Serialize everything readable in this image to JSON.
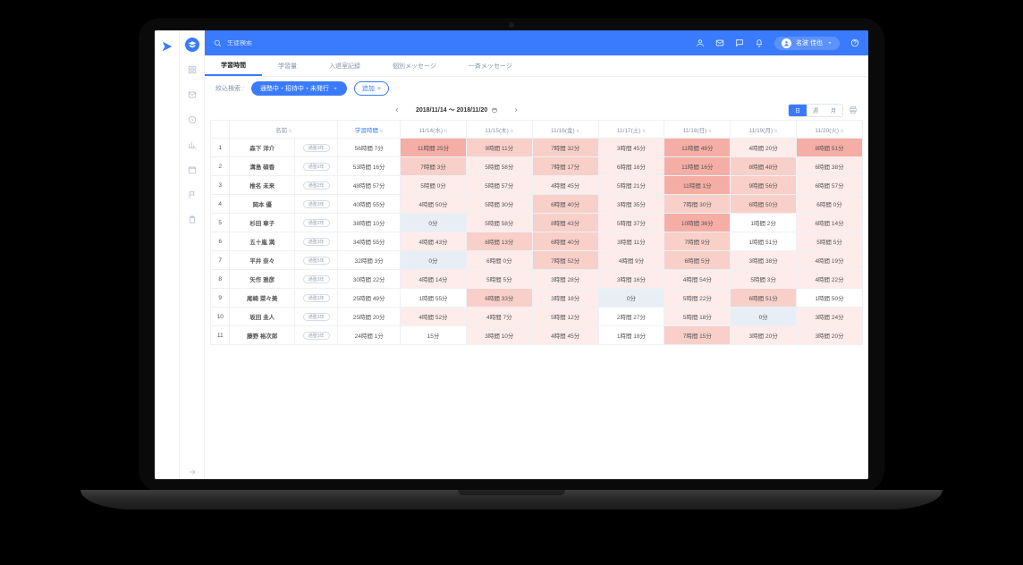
{
  "search": {
    "placeholder": "生徒検索"
  },
  "user": {
    "name": "名波 佳也"
  },
  "tabs": [
    "学習時間",
    "学習量",
    "入退室記録",
    "個別メッセージ",
    "一斉メッセージ"
  ],
  "filter": {
    "label": "絞込検索 :",
    "pill": "通塾中・招待中・未発行",
    "add": "追加"
  },
  "dateRange": "2018/11/14 〜 2018/11/20",
  "segments": [
    "日",
    "週",
    "月"
  ],
  "columns": {
    "name": "名前",
    "study": "学習時間",
    "days": [
      "11/14(水)",
      "11/15(木)",
      "11/16(金)",
      "11/17(土)",
      "11/18(日)",
      "11/19(月)",
      "11/20(火)"
    ]
  },
  "badgeText": "通塾3年",
  "rows": [
    {
      "n": "森下 洋介",
      "badge": "通塾3年",
      "t": "56時間 7分",
      "c": [
        {
          "v": "11時間 25分",
          "h": 3
        },
        {
          "v": "9時間 11分",
          "h": 2
        },
        {
          "v": "7時間 32分",
          "h": 2
        },
        {
          "v": "3時間 45分",
          "h": 1
        },
        {
          "v": "11時間 48分",
          "h": 3
        },
        {
          "v": "4時間 20分",
          "h": 1
        },
        {
          "v": "8時間 51分",
          "h": 3
        }
      ]
    },
    {
      "n": "溝島 碩香",
      "badge": "通塾3年",
      "t": "53時間 16分",
      "c": [
        {
          "v": "7時間 3分",
          "h": 2
        },
        {
          "v": "5時間 58分",
          "h": 1
        },
        {
          "v": "7時間 17分",
          "h": 2
        },
        {
          "v": "6時間 16分",
          "h": 1
        },
        {
          "v": "11時間 16分",
          "h": 3
        },
        {
          "v": "8時間 48分",
          "h": 2
        },
        {
          "v": "6時間 38分",
          "h": 1
        }
      ]
    },
    {
      "n": "椎名 未来",
      "badge": "通塾2年",
      "t": "48時間 57分",
      "c": [
        {
          "v": "5時間 0分",
          "h": 1
        },
        {
          "v": "5時間 57分",
          "h": 1
        },
        {
          "v": "4時間 45分",
          "h": 1
        },
        {
          "v": "5時間 21分",
          "h": 1
        },
        {
          "v": "11時間 1分",
          "h": 3
        },
        {
          "v": "9時間 56分",
          "h": 2
        },
        {
          "v": "6時間 57分",
          "h": 1
        }
      ]
    },
    {
      "n": "岡本 優",
      "badge": "通塾3年",
      "t": "40時間 55分",
      "c": [
        {
          "v": "4時間 50分",
          "h": 1
        },
        {
          "v": "5時間 30分",
          "h": 1
        },
        {
          "v": "6時間 40分",
          "h": 2
        },
        {
          "v": "3時間 35分",
          "h": 1
        },
        {
          "v": "7時間 30分",
          "h": 2
        },
        {
          "v": "6時間 50分",
          "h": 2
        },
        {
          "v": "6時間 0分",
          "h": 1
        }
      ]
    },
    {
      "n": "杉田 章子",
      "badge": "通塾2年",
      "t": "38時間 10分",
      "c": [
        {
          "v": "0分",
          "h": -1
        },
        {
          "v": "5時間 58分",
          "h": 1
        },
        {
          "v": "8時間 43分",
          "h": 2
        },
        {
          "v": "5時間 37分",
          "h": 1
        },
        {
          "v": "10時間 36分",
          "h": 3
        },
        {
          "v": "1時間 2分",
          "h": 0
        },
        {
          "v": "6時間 14分",
          "h": 1
        }
      ]
    },
    {
      "n": "五十嵐 満",
      "badge": "通塾3年",
      "t": "34時間 55分",
      "c": [
        {
          "v": "4時間 43分",
          "h": 1
        },
        {
          "v": "6時間 13分",
          "h": 2
        },
        {
          "v": "6時間 40分",
          "h": 2
        },
        {
          "v": "3時間 11分",
          "h": 1
        },
        {
          "v": "7時間 9分",
          "h": 2
        },
        {
          "v": "1時間 51分",
          "h": 0
        },
        {
          "v": "5時間 5分",
          "h": 1
        }
      ]
    },
    {
      "n": "平井 奈々",
      "badge": "通塾5年",
      "t": "32時間 3分",
      "c": [
        {
          "v": "0分",
          "h": -1
        },
        {
          "v": "6時間 0分",
          "h": 1
        },
        {
          "v": "7時間 52分",
          "h": 2
        },
        {
          "v": "4時間 9分",
          "h": 1
        },
        {
          "v": "6時間 5分",
          "h": 2
        },
        {
          "v": "3時間 38分",
          "h": 1
        },
        {
          "v": "4時間 19分",
          "h": 1
        }
      ]
    },
    {
      "n": "矢作 雅彦",
      "badge": "通塾3年",
      "t": "30時間 22分",
      "c": [
        {
          "v": "4時間 14分",
          "h": 1
        },
        {
          "v": "5時間 5分",
          "h": 1
        },
        {
          "v": "3時間 28分",
          "h": 1
        },
        {
          "v": "3時間 16分",
          "h": 1
        },
        {
          "v": "4時間 54分",
          "h": 1
        },
        {
          "v": "5時間 3分",
          "h": 1
        },
        {
          "v": "4時間 22分",
          "h": 1
        }
      ]
    },
    {
      "n": "尾崎 菜々美",
      "badge": "通塾3年",
      "t": "25時間 49分",
      "c": [
        {
          "v": "1時間 55分",
          "h": 0
        },
        {
          "v": "6時間 33分",
          "h": 2
        },
        {
          "v": "3時間 18分",
          "h": 1
        },
        {
          "v": "0分",
          "h": -1
        },
        {
          "v": "5時間 22分",
          "h": 1
        },
        {
          "v": "6時間 51分",
          "h": 2
        },
        {
          "v": "1時間 50分",
          "h": 0
        }
      ]
    },
    {
      "n": "坂田 圭人",
      "badge": "通塾3年",
      "t": "25時間 20分",
      "c": [
        {
          "v": "4時間 52分",
          "h": 1
        },
        {
          "v": "4時間 7分",
          "h": 1
        },
        {
          "v": "5時間 12分",
          "h": 1
        },
        {
          "v": "2時間 27分",
          "h": 0
        },
        {
          "v": "5時間 18分",
          "h": 1
        },
        {
          "v": "0分",
          "h": -1
        },
        {
          "v": "3時間 24分",
          "h": 1
        }
      ]
    },
    {
      "n": "藤野 裕次郎",
      "badge": "通塾3年",
      "t": "24時間 1分",
      "c": [
        {
          "v": "15分",
          "h": 0
        },
        {
          "v": "3時間 10分",
          "h": 1
        },
        {
          "v": "4時間 45分",
          "h": 1
        },
        {
          "v": "1時間 18分",
          "h": 0
        },
        {
          "v": "7時間 15分",
          "h": 2
        },
        {
          "v": "3時間 20分",
          "h": 1
        },
        {
          "v": "3時間 20分",
          "h": 1
        }
      ]
    }
  ]
}
